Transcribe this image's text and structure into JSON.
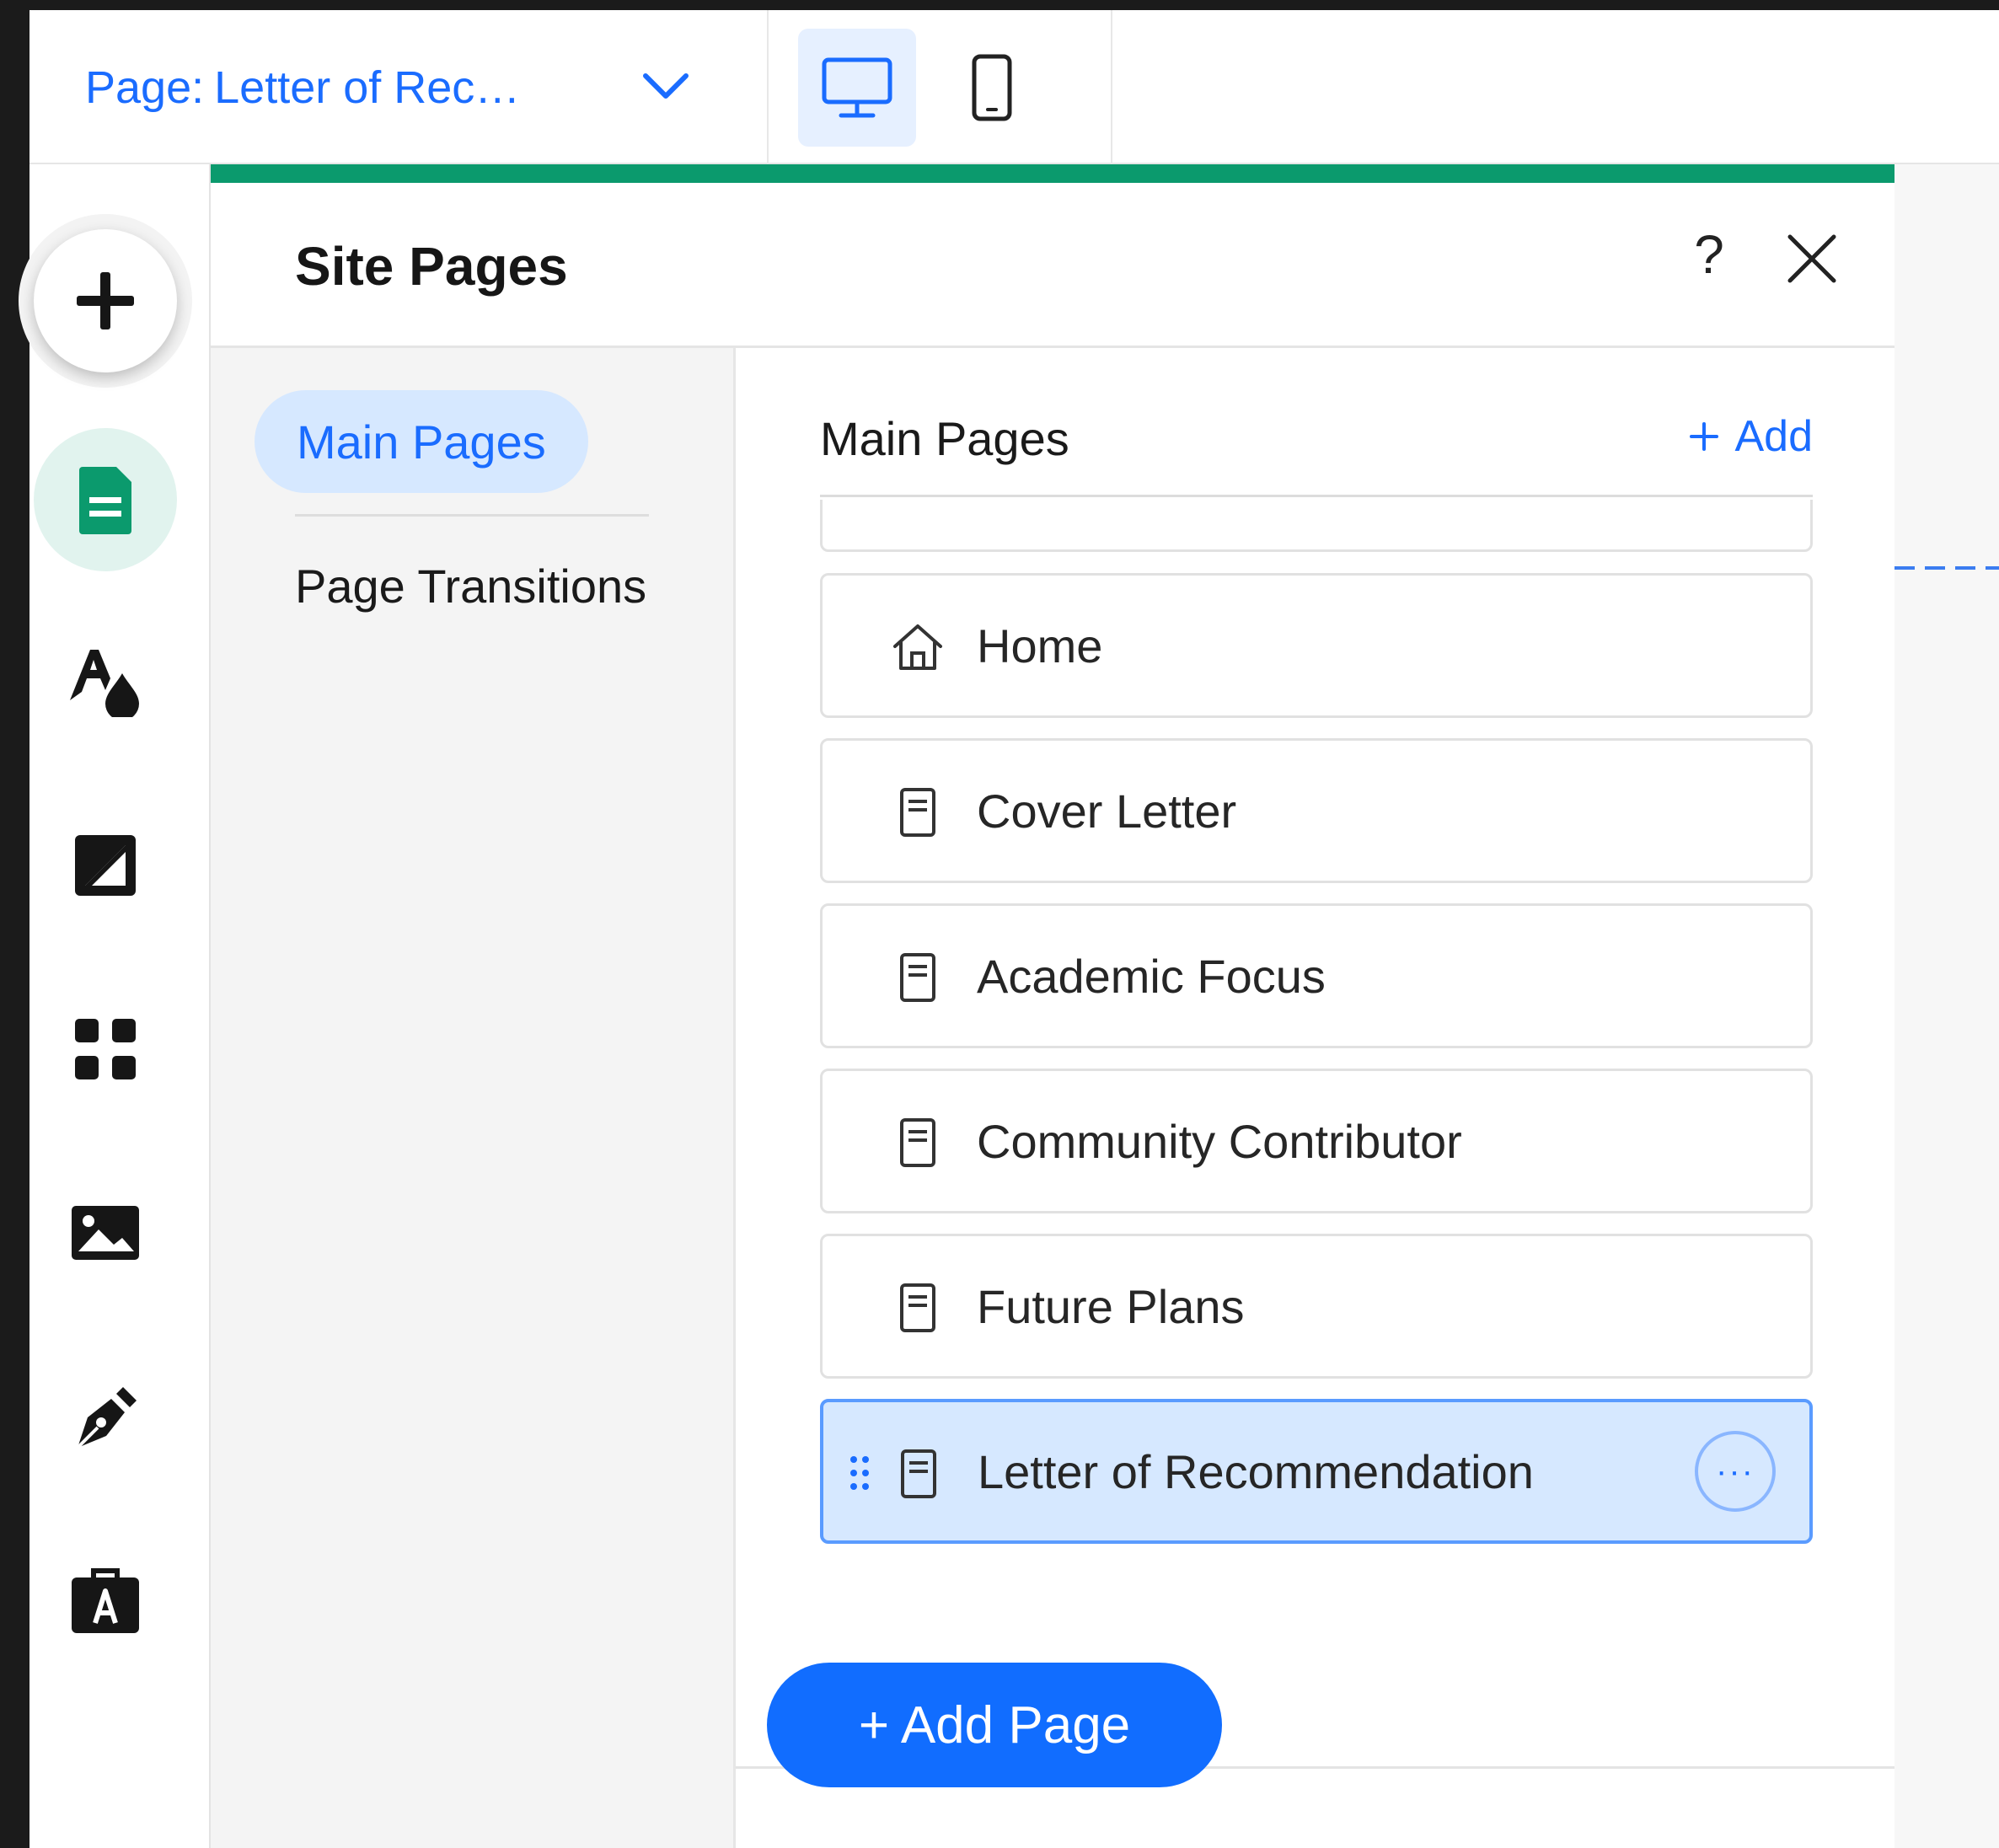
{
  "topbar": {
    "page_label": "Page:",
    "page_value": "Letter of Rec…",
    "devices": [
      {
        "name": "desktop",
        "active": true
      },
      {
        "name": "mobile",
        "active": false
      }
    ]
  },
  "rail": {
    "items": [
      {
        "icon": "plus-icon"
      },
      {
        "icon": "pages-icon",
        "active": true
      },
      {
        "icon": "theme-icon"
      },
      {
        "icon": "background-icon"
      },
      {
        "icon": "apps-icon"
      },
      {
        "icon": "media-icon"
      },
      {
        "icon": "pen-icon"
      },
      {
        "icon": "portfolio-icon"
      }
    ]
  },
  "panel": {
    "title": "Site Pages",
    "help_label": "?",
    "tabs": [
      {
        "label": "Main Pages",
        "active": true
      },
      {
        "label": "Page Transitions",
        "active": false
      }
    ],
    "list_title": "Main Pages",
    "add_label": "Add",
    "pages": [
      {
        "label": "",
        "icon": "none"
      },
      {
        "label": "Home",
        "icon": "home-icon"
      },
      {
        "label": "Cover Letter",
        "icon": "page-icon"
      },
      {
        "label": "Academic Focus",
        "icon": "page-icon"
      },
      {
        "label": "Community Contributor",
        "icon": "page-icon"
      },
      {
        "label": "Future Plans",
        "icon": "page-icon"
      },
      {
        "label": "Letter of Recommendation",
        "icon": "page-icon",
        "selected": true
      }
    ],
    "more_label": "···",
    "add_page_label": "+ Add Page"
  },
  "colors": {
    "accent_blue": "#116dff",
    "accent_green": "#0b9a6d",
    "selected_bg": "#d6e8ff"
  }
}
